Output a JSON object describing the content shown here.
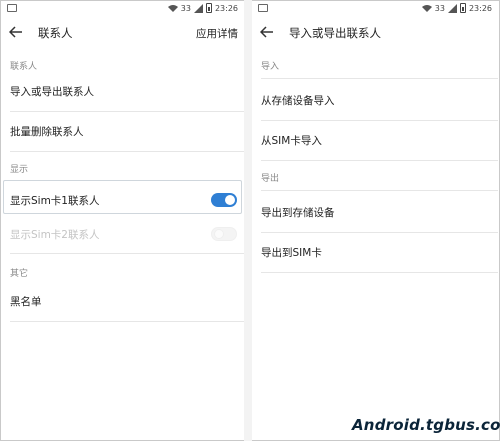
{
  "status": {
    "signal": "33",
    "time": "23:26"
  },
  "left": {
    "title": "联系人",
    "action": "应用详情",
    "sections": {
      "contacts": {
        "label": "联系人",
        "items": [
          "导入或导出联系人",
          "批量删除联系人"
        ]
      },
      "display": {
        "label": "显示",
        "sim1": {
          "label": "显示Sim卡1联系人",
          "on": true
        },
        "sim2": {
          "label": "显示Sim卡2联系人",
          "on": false,
          "disabled": true
        }
      },
      "other": {
        "label": "其它",
        "items": [
          "黑名单"
        ]
      }
    }
  },
  "right": {
    "title": "导入或导出联系人",
    "sections": {
      "import": {
        "label": "导入",
        "items": [
          "从存储设备导入",
          "从SIM卡导入"
        ]
      },
      "export": {
        "label": "导出",
        "items": [
          "导出到存储设备",
          "导出到SIM卡"
        ]
      }
    }
  },
  "watermark": "Android.tgbus.com",
  "colors": {
    "accent": "#2f7fd4",
    "section_text": "#888888",
    "disabled_text": "#c4c4c4"
  },
  "icons": [
    "back-arrow-icon",
    "wifi-icon",
    "signal-icon",
    "battery-icon",
    "image-icon"
  ]
}
